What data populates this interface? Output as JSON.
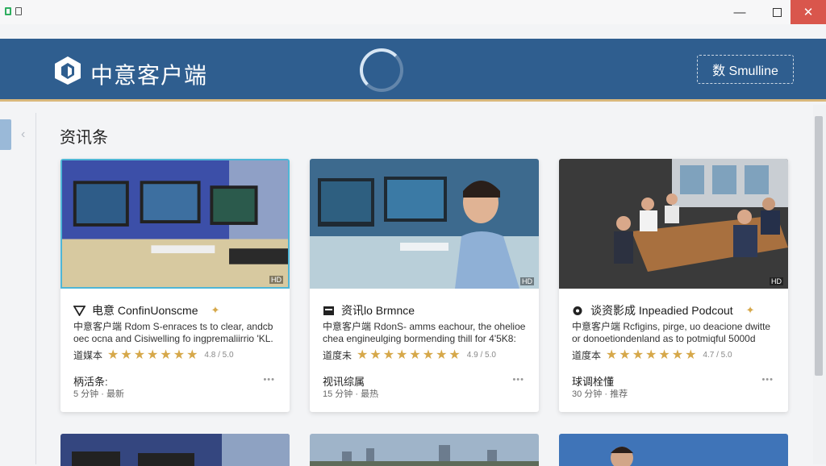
{
  "window": {
    "minimize_glyph": "—",
    "close_glyph": "✕"
  },
  "header": {
    "app_title": "中意客户端",
    "action_button": "数 Smulline"
  },
  "section": {
    "title": "资讯条"
  },
  "cards": [
    {
      "title_icon": "triangle-icon",
      "title": "电意 ConfinUonscme",
      "desc": "中意客户端 Rdom S-enraces ts to clear, andcb oec ocna and Cisiwelling fo ingpremaliirrio 'KL.",
      "rating_label": "道媒本",
      "stars": "★★★★★★★",
      "rating_value": "4.8 / 5.0",
      "meta_label": "柄活条:",
      "meta_sub": "5 分钟 · 最新"
    },
    {
      "title_icon": "tv-icon",
      "title": "资讯lo Brmnce",
      "desc": "中意客户端 RdonS- amms eachour, the ohelioe chea engineulging bormending thill for 4'5K8:",
      "rating_label": "道度未",
      "stars": "★★★★★★★★",
      "rating_value": "4.9 / 5.0",
      "meta_label": "视讯综属",
      "meta_sub": "15 分钟 · 最热"
    },
    {
      "title_icon": "podcast-icon",
      "title": "谈资影成 Inpeadied Podcout",
      "desc": "中意客户端 Rcfigins, pirge, uo deacione dwitte or donoetiondenland as to potmiqful 5000d",
      "rating_label": "道度本",
      "stars": "★★★★★★★",
      "rating_value": "4.7 / 5.0",
      "meta_label": "球调栓懂",
      "meta_sub": "30 分钟 · 推荐"
    }
  ],
  "more_glyph": "•••",
  "thumb_badge": "HD",
  "colors": {
    "header_bg": "#2f5e8f",
    "accent_gold": "#d9b87c",
    "star": "#d6a84a",
    "close_btn": "#d9564c",
    "selected_border": "#4fb6d6"
  }
}
